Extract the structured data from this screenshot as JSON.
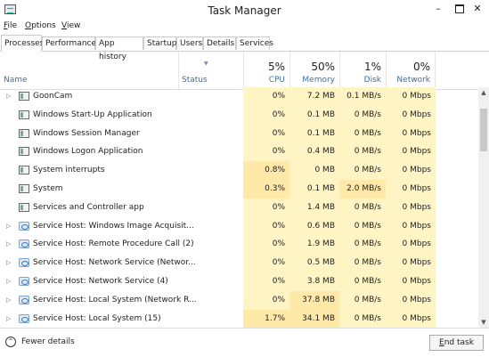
{
  "window": {
    "title": "Task Manager",
    "minimize": "–",
    "close": "✕"
  },
  "menu": [
    {
      "pre": "",
      "key": "F",
      "post": "ile"
    },
    {
      "pre": "",
      "key": "O",
      "post": "ptions"
    },
    {
      "pre": "",
      "key": "V",
      "post": "iew"
    }
  ],
  "tabs": [
    "Processes",
    "Performance",
    "App history",
    "Startup",
    "Users",
    "Details",
    "Services"
  ],
  "columns": {
    "name": "Name",
    "status": "Status",
    "cpu": {
      "pct": "5%",
      "label": "CPU"
    },
    "memory": {
      "pct": "50%",
      "label": "Memory"
    },
    "disk": {
      "pct": "1%",
      "label": "Disk"
    },
    "network": {
      "pct": "0%",
      "label": "Network"
    }
  },
  "processes": [
    {
      "name": "GoonCam",
      "cpu": "0%",
      "memory": "7.2 MB",
      "disk": "0.1 MB/s",
      "network": "0 Mbps",
      "expandable": true,
      "icon": "app-window-icon"
    },
    {
      "name": "Windows Start-Up Application",
      "cpu": "0%",
      "memory": "0.1 MB",
      "disk": "0 MB/s",
      "network": "0 Mbps",
      "expandable": false,
      "icon": "app-window-icon"
    },
    {
      "name": "Windows Session Manager",
      "cpu": "0%",
      "memory": "0.1 MB",
      "disk": "0 MB/s",
      "network": "0 Mbps",
      "expandable": false,
      "icon": "app-window-icon"
    },
    {
      "name": "Windows Logon Application",
      "cpu": "0%",
      "memory": "0.4 MB",
      "disk": "0 MB/s",
      "network": "0 Mbps",
      "expandable": false,
      "icon": "app-window-icon"
    },
    {
      "name": "System interrupts",
      "cpu": "0.8%",
      "memory": "0 MB",
      "disk": "0 MB/s",
      "network": "0 Mbps",
      "expandable": false,
      "icon": "app-window-icon"
    },
    {
      "name": "System",
      "cpu": "0.3%",
      "memory": "0.1 MB",
      "disk": "2.0 MB/s",
      "network": "0 Mbps",
      "expandable": false,
      "icon": "app-window-icon"
    },
    {
      "name": "Services and Controller app",
      "cpu": "0%",
      "memory": "1.4 MB",
      "disk": "0 MB/s",
      "network": "0 Mbps",
      "expandable": false,
      "icon": "app-window-icon"
    },
    {
      "name": "Service Host: Windows Image Acquisit...",
      "cpu": "0%",
      "memory": "0.6 MB",
      "disk": "0 MB/s",
      "network": "0 Mbps",
      "expandable": true,
      "icon": "gear-icon"
    },
    {
      "name": "Service Host: Remote Procedure Call (2)",
      "cpu": "0%",
      "memory": "1.9 MB",
      "disk": "0 MB/s",
      "network": "0 Mbps",
      "expandable": true,
      "icon": "gear-icon"
    },
    {
      "name": "Service Host: Network Service (Networ...",
      "cpu": "0%",
      "memory": "0.5 MB",
      "disk": "0 MB/s",
      "network": "0 Mbps",
      "expandable": true,
      "icon": "gear-icon"
    },
    {
      "name": "Service Host: Network Service (4)",
      "cpu": "0%",
      "memory": "3.8 MB",
      "disk": "0 MB/s",
      "network": "0 Mbps",
      "expandable": true,
      "icon": "gear-icon"
    },
    {
      "name": "Service Host: Local System (Network R...",
      "cpu": "0%",
      "memory": "37.8 MB",
      "disk": "0 MB/s",
      "network": "0 Mbps",
      "expandable": true,
      "icon": "gear-icon"
    },
    {
      "name": "Service Host: Local System (15)",
      "cpu": "1.7%",
      "memory": "34.1 MB",
      "disk": "0 MB/s",
      "network": "0 Mbps",
      "expandable": true,
      "icon": "gear-icon"
    }
  ],
  "footer": {
    "fewer_details": "Fewer details",
    "end_task_key": "E",
    "end_task_rest": "nd task"
  },
  "colors": {
    "heat_low": "#fff4c4",
    "heat_mid": "#ffe9a8",
    "heat_high": "#fdd889",
    "header_label": "#3a6ea5"
  }
}
